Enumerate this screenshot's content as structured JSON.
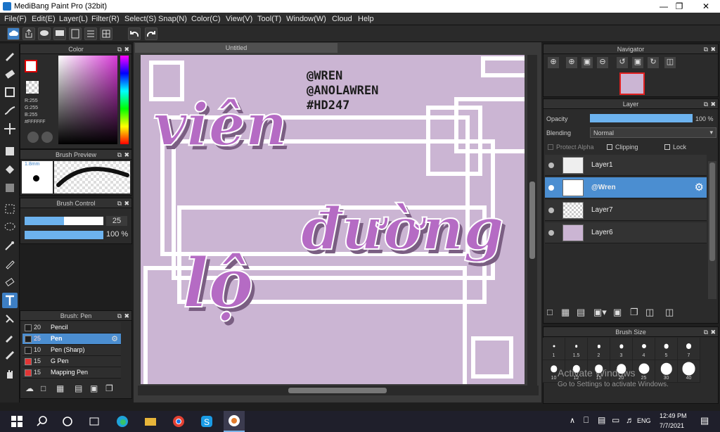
{
  "window": {
    "title": "MediBang Paint Pro (32bit)"
  },
  "menu": [
    "File(F)",
    "Edit(E)",
    "Layer(L)",
    "Filter(R)",
    "Select(S)",
    "Snap(N)",
    "Color(C)",
    "View(V)",
    "Tool(T)",
    "Window(W)",
    "Cloud",
    "Help"
  ],
  "color_panel": {
    "title": "Color",
    "r": "R:255",
    "g": "G:255",
    "b": "B:255",
    "hex": "#FFFFFF"
  },
  "brush_preview": {
    "title": "Brush Preview",
    "size": "1.8mm"
  },
  "brush_control": {
    "title": "Brush Control",
    "size_value": "25",
    "opacity_value": "100 %",
    "size_fraction": 0.5,
    "opacity_fraction": 1.0
  },
  "brush_panel": {
    "title": "Brush: Pen",
    "items": [
      {
        "size": "20",
        "name": "Pencil",
        "color": "#1e1e1e"
      },
      {
        "size": "25",
        "name": "Pen",
        "color": "#1e1e1e"
      },
      {
        "size": "10",
        "name": "Pen (Sharp)",
        "color": "#1e1e1e"
      },
      {
        "size": "15",
        "name": "G Pen",
        "color": "#e23535"
      },
      {
        "size": "15",
        "name": "Mapping Pen",
        "color": "#e23535"
      }
    ]
  },
  "document": {
    "tab": "Untitled",
    "tags": [
      "@WREN",
      "@ANOLAWREN",
      "#HD247"
    ],
    "words": [
      "viên",
      "đường",
      "lộ"
    ]
  },
  "navigator": {
    "title": "Navigator"
  },
  "layer_panel": {
    "title": "Layer",
    "opacity_label": "Opacity",
    "opacity_value": "100 %",
    "opacity_fraction": 1.0,
    "blending_label": "Blending",
    "blending_value": "Normal",
    "protect_alpha": "Protect Alpha",
    "clipping": "Clipping",
    "lock": "Lock",
    "layers": [
      {
        "name": "Layer1"
      },
      {
        "name": "@Wren"
      },
      {
        "name": "Layer7"
      },
      {
        "name": "Layer6"
      }
    ]
  },
  "brush_size": {
    "title": "Brush Size",
    "sizes": [
      "1",
      "1.5",
      "2",
      "3",
      "4",
      "5",
      "7",
      "10",
      "12",
      "15",
      "20",
      "25",
      "30",
      "40"
    ]
  },
  "watermark": {
    "line1": "Activate Windows",
    "line2": "Go to Settings to activate Windows."
  },
  "taskbar": {
    "time": "12:49 PM",
    "date": "7/7/2021",
    "lang": "ENG"
  }
}
